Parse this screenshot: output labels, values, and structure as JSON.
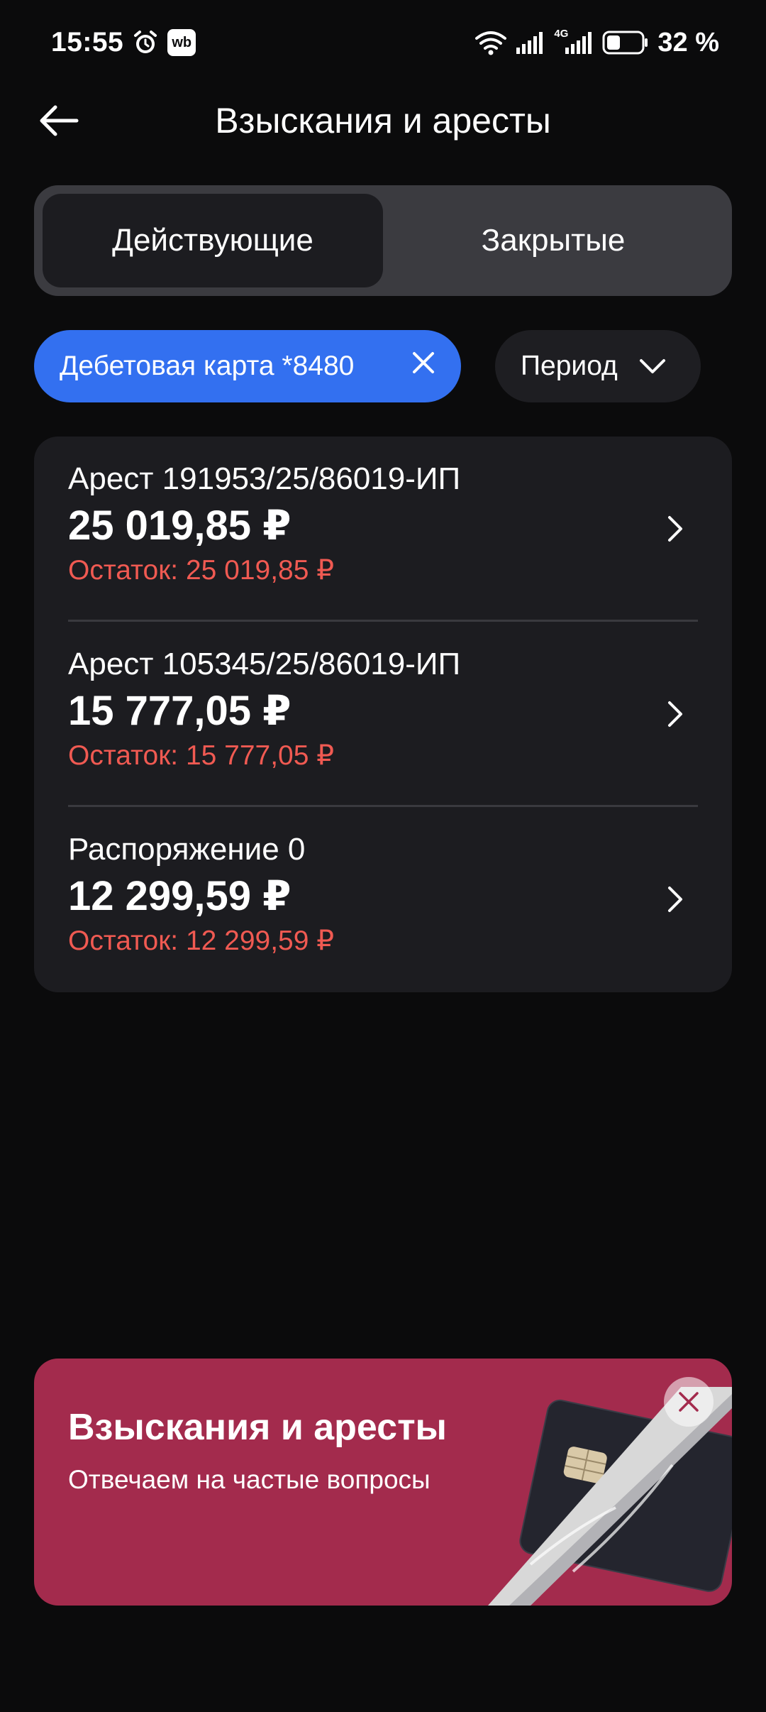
{
  "status_bar": {
    "time": "15:55",
    "wb_badge": "wb",
    "network": "4G",
    "battery": "32 %"
  },
  "header": {
    "title": "Взыскания и аресты"
  },
  "tabs": [
    {
      "label": "Действующие",
      "selected": true
    },
    {
      "label": "Закрытые",
      "selected": false
    }
  ],
  "filters": {
    "card_chip": "Дебетовая карта *8480",
    "period_chip": "Период"
  },
  "items": [
    {
      "title": "Арест 191953/25/86019-ИП",
      "amount": "25 019,85 ₽",
      "rest": "Остаток: 25 019,85 ₽"
    },
    {
      "title": "Арест 105345/25/86019-ИП",
      "amount": "15 777,05 ₽",
      "rest": "Остаток: 15 777,05 ₽"
    },
    {
      "title": "Распоряжение 0",
      "amount": "12 299,59 ₽",
      "rest": "Остаток: 12 299,59 ₽"
    }
  ],
  "promo": {
    "title": "Взыскания и аресты",
    "subtitle": "Отвечаем на частые вопросы"
  },
  "colors": {
    "background": "#0b0b0c",
    "chip_accent": "#3370f0",
    "remainder_text": "#f05a52",
    "promo_background": "#a32b4d"
  }
}
